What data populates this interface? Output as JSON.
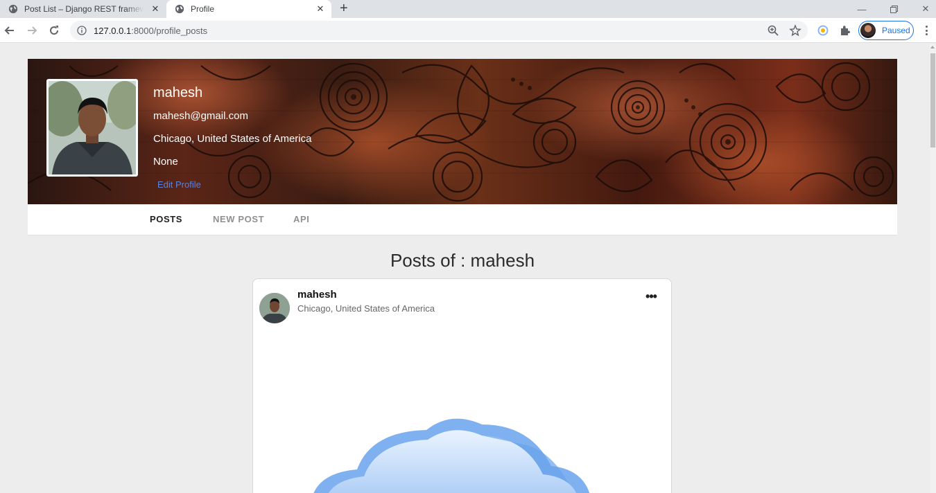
{
  "browser": {
    "tabs": [
      {
        "title": "Post List – Django REST framework",
        "active": false
      },
      {
        "title": "Profile",
        "active": true
      }
    ],
    "url_host": "127.0.0.1",
    "url_rest": ":8000/profile_posts",
    "profile_status": "Paused"
  },
  "profile": {
    "name": "mahesh",
    "email": "mahesh@gmail.com",
    "location": "Chicago, United States of America",
    "bio": "None",
    "edit_label": "Edit Profile"
  },
  "nav": {
    "items": [
      {
        "label": "POSTS",
        "active": true
      },
      {
        "label": "NEW POST",
        "active": false
      },
      {
        "label": "API",
        "active": false
      }
    ]
  },
  "posts": {
    "heading": "Posts of : mahesh",
    "items": [
      {
        "author": "mahesh",
        "location": "Chicago, United States of America",
        "menu_icon": "more-horizontal-icon"
      }
    ]
  },
  "colors": {
    "accent_link": "#5b83d8",
    "chrome_blue": "#1a73e8",
    "page_bg": "#ededed"
  }
}
